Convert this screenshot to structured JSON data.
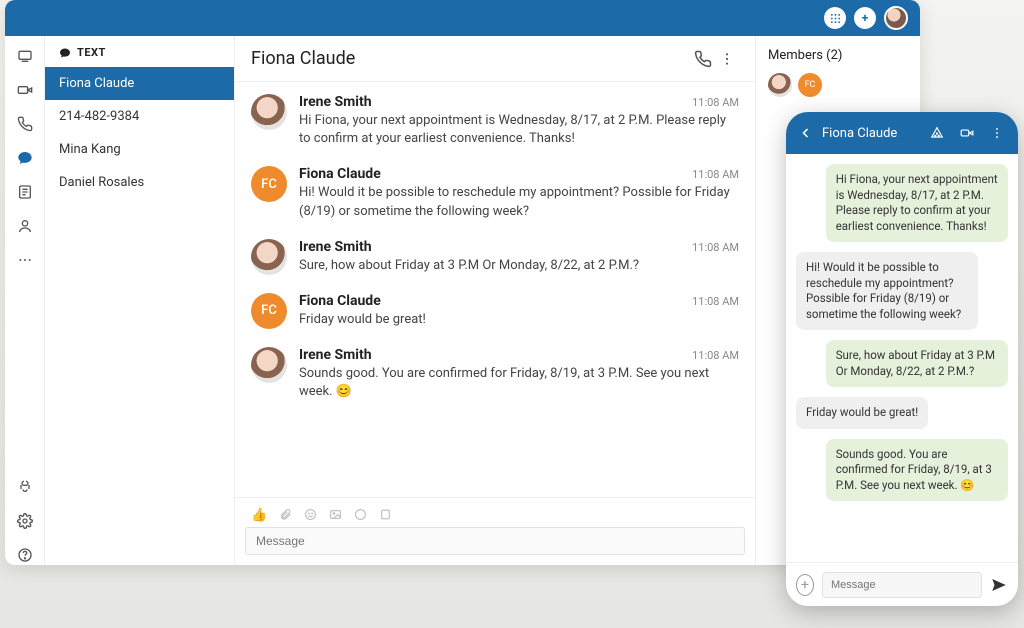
{
  "sidebar": {
    "section_label": "TEXT",
    "conversations": [
      {
        "name": "Fiona Claude",
        "active": true
      },
      {
        "name": "214-482-9384",
        "active": false
      },
      {
        "name": "Mina Kang",
        "active": false
      },
      {
        "name": "Daniel Rosales",
        "active": false
      }
    ]
  },
  "chat": {
    "title": "Fiona Claude",
    "compose_placeholder": "Message",
    "messages": [
      {
        "sender": "Irene Smith",
        "time": "11:08 AM",
        "text": "Hi Fiona, your next appointment is Wednesday, 8/17, at 2 P.M. Please reply to confirm at your earliest convenience. Thanks!",
        "avatar": "irene"
      },
      {
        "sender": "Fiona Claude",
        "time": "11:08 AM",
        "text": "Hi! Would it be possible to  reschedule my appointment? Possible for Friday (8/19) or sometime the following week?",
        "avatar": "fc",
        "initials": "FC"
      },
      {
        "sender": "Irene Smith",
        "time": "11:08 AM",
        "text": "Sure, how about Friday at 3 P.M Or Monday, 8/22, at 2 P.M.?",
        "avatar": "irene"
      },
      {
        "sender": "Fiona Claude",
        "time": "11:08 AM",
        "text": "Friday would be great!",
        "avatar": "fc",
        "initials": "FC"
      },
      {
        "sender": "Irene Smith",
        "time": "11:08 AM",
        "text": "Sounds good. You are confirmed for Friday, 8/19, at 3 P.M. See you next week. 😊",
        "avatar": "irene"
      }
    ]
  },
  "members": {
    "title": "Members (2)",
    "list": [
      {
        "avatar": "irene"
      },
      {
        "avatar": "fc",
        "initials": "FC"
      }
    ]
  },
  "mobile": {
    "title": "Fiona Claude",
    "compose_placeholder": "Message",
    "messages": [
      {
        "dir": "out",
        "text": "Hi Fiona, your next appointment is Wednesday, 8/17, at 2 P.M. Please reply to confirm at your earliest convenience. Thanks!"
      },
      {
        "dir": "in",
        "text": "Hi! Would it be possible to reschedule my appointment? Possible for Friday (8/19) or sometime the following week?"
      },
      {
        "dir": "out",
        "text": "Sure, how about Friday at 3 P.M Or Monday, 8/22, at 2 P.M.?"
      },
      {
        "dir": "in",
        "text": "Friday would be great!"
      },
      {
        "dir": "out",
        "text": "Sounds good. You are confirmed for Friday, 8/19, at 3 P.M. See you next week. 😊"
      }
    ]
  }
}
